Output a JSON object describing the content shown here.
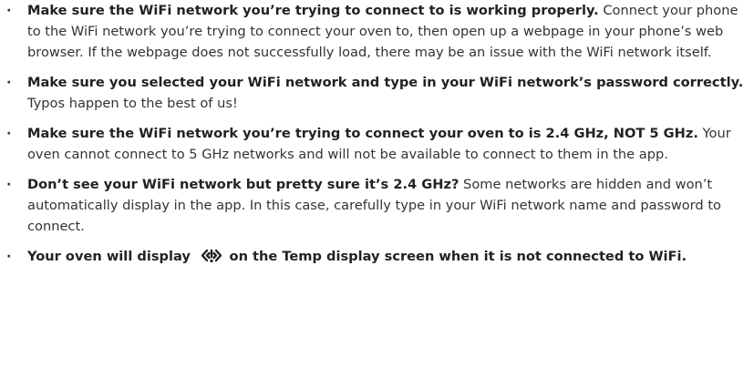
{
  "items": [
    {
      "bullet": "·",
      "bold": "Make sure the WiFi network you’re trying to connect to is working properly.",
      "text": " Connect your phone to the WiFi network you’re trying to connect your oven to, then open up a webpage in your phone’s web browser. If the webpage does not successfully load, there may be an issue with the WiFi network itself."
    },
    {
      "bullet": "·",
      "bold": "Make sure you selected your WiFi network and type in your WiFi network’s password correctly.",
      "text": " Typos happen to the best of us!"
    },
    {
      "bullet": "·",
      "bold": "Make sure the WiFi network you’re trying to connect your oven to is 2.4 GHz, NOT 5 GHz.",
      "text": " Your oven cannot connect to 5 GHz networks and will not be available to connect to them in the app."
    },
    {
      "bullet": "·",
      "bold": "Don’t see your WiFi network but pretty sure it’s 2.4 GHz?",
      "text": " Some networks are hidden and won’t automatically display in the app. In this case, carefully type in your WiFi network name and password to connect."
    },
    {
      "bullet": "·",
      "bold_before_icon": "Your oven will display",
      "icon": "wifi-disconnected-icon",
      "bold_after_icon": "on the Temp display screen when it is not connected to WiFi."
    }
  ],
  "colors": {
    "text": "#333333",
    "bold_text": "#222222",
    "background": "#ffffff"
  }
}
